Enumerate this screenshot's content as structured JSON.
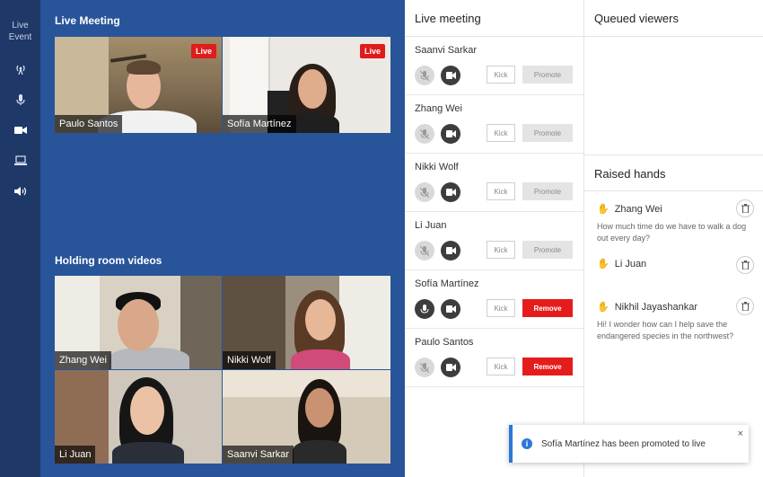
{
  "rail": {
    "title_line1": "Live",
    "title_line2": "Event",
    "icons": [
      "broadcast-icon",
      "microphone-icon",
      "camera-icon",
      "laptop-icon",
      "speaker-icon"
    ]
  },
  "stage": {
    "live_title": "Live Meeting",
    "live_badge": "Live",
    "live_tiles": [
      "Paulo Santos",
      "Sofía Martínez"
    ],
    "holding_title": "Holding room videos",
    "holding_tiles": [
      "Zhang Wei",
      "Nikki Wolf",
      "Li Juan",
      "Saanvi Sarkar"
    ]
  },
  "live_meeting": {
    "title": "Live meeting",
    "kick_label": "Kick",
    "participants": [
      {
        "name": "Saanvi Sarkar",
        "mic_on": false,
        "action": "Promote"
      },
      {
        "name": "Zhang Wei",
        "mic_on": false,
        "action": "Promote"
      },
      {
        "name": "Nikki Wolf",
        "mic_on": false,
        "action": "Promote"
      },
      {
        "name": "Li Juan",
        "mic_on": false,
        "action": "Promote"
      },
      {
        "name": "Sofía Martínez",
        "mic_on": true,
        "action": "Remove"
      },
      {
        "name": "Paulo Santos",
        "mic_on": false,
        "action": "Remove"
      }
    ]
  },
  "queued": {
    "title": "Queued viewers"
  },
  "raised_hands": {
    "title": "Raised hands",
    "items": [
      {
        "name": "Zhang Wei",
        "question": "How much time do we have to walk a dog out every day?"
      },
      {
        "name": "Li Juan",
        "question": ""
      },
      {
        "name": "Nikhil Jayashankar",
        "question": "Hi! I wonder how can I help save the endangered species in the northwest?"
      }
    ]
  },
  "toast": {
    "message": "Sofía Martínez has been promoted to live",
    "info_glyph": "i",
    "close_glyph": "×"
  },
  "colors": {
    "rail": "#1e3867",
    "stage": "#28549a",
    "live_red": "#e01b1b",
    "remove_red": "#e51c1c",
    "toast_accent": "#2d78d6"
  }
}
